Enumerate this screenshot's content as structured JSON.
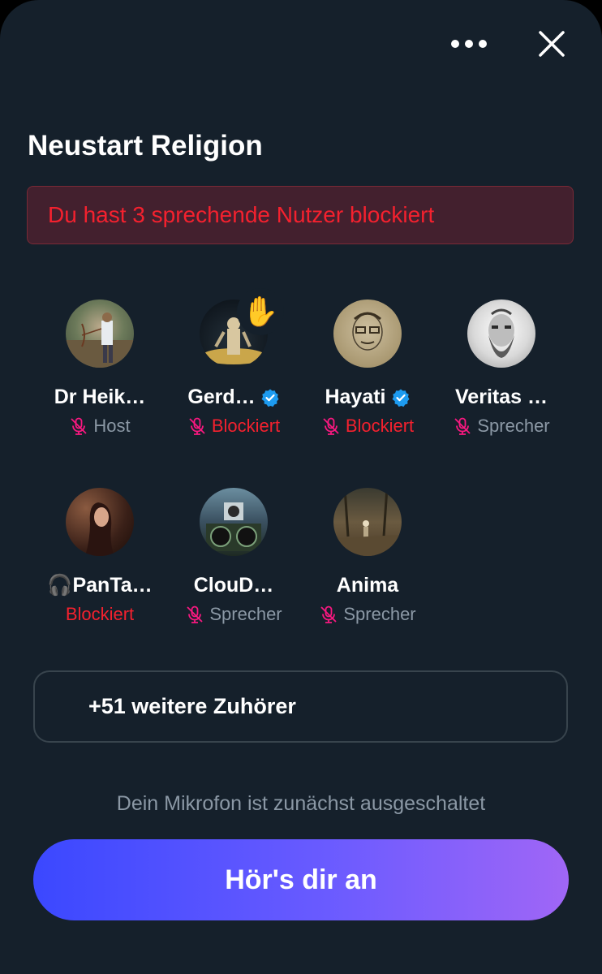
{
  "header": {
    "more_icon": "more-horizontal-icon",
    "close_icon": "close-icon"
  },
  "space": {
    "title": "Neustart Religion",
    "blocked_banner": "Du hast 3 sprechende Nutzer blockiert"
  },
  "participants": [
    {
      "name": "Dr Heik…",
      "role": "Host",
      "role_type": "host",
      "verified": false,
      "hand_raised": false
    },
    {
      "name": "Gerd…",
      "role": "Blockiert",
      "role_type": "blocked",
      "verified": true,
      "hand_raised": true
    },
    {
      "name": "Hayati",
      "role": "Blockiert",
      "role_type": "blocked",
      "verified": true,
      "hand_raised": false
    },
    {
      "name": "Veritas …",
      "role": "Sprecher",
      "role_type": "speaker",
      "verified": false,
      "hand_raised": false
    },
    {
      "name": "🎧PanTa…",
      "role": "Blockiert",
      "role_type": "blocked",
      "verified": false,
      "hand_raised": false
    },
    {
      "name": "ClouD…",
      "role": "Sprecher",
      "role_type": "speaker",
      "verified": false,
      "hand_raised": false
    },
    {
      "name": "Anima",
      "role": "Sprecher",
      "role_type": "speaker",
      "verified": false,
      "hand_raised": false
    }
  ],
  "listeners_label": "+51 weitere Zuhörer",
  "mic_note": "Dein Mikrofon ist zunächst ausgeschaltet",
  "cta_label": "Hör's dir an",
  "colors": {
    "background": "#15202b",
    "blocked": "#f4212e",
    "muted_mic": "#f91880",
    "verified": "#1d9bf0"
  }
}
